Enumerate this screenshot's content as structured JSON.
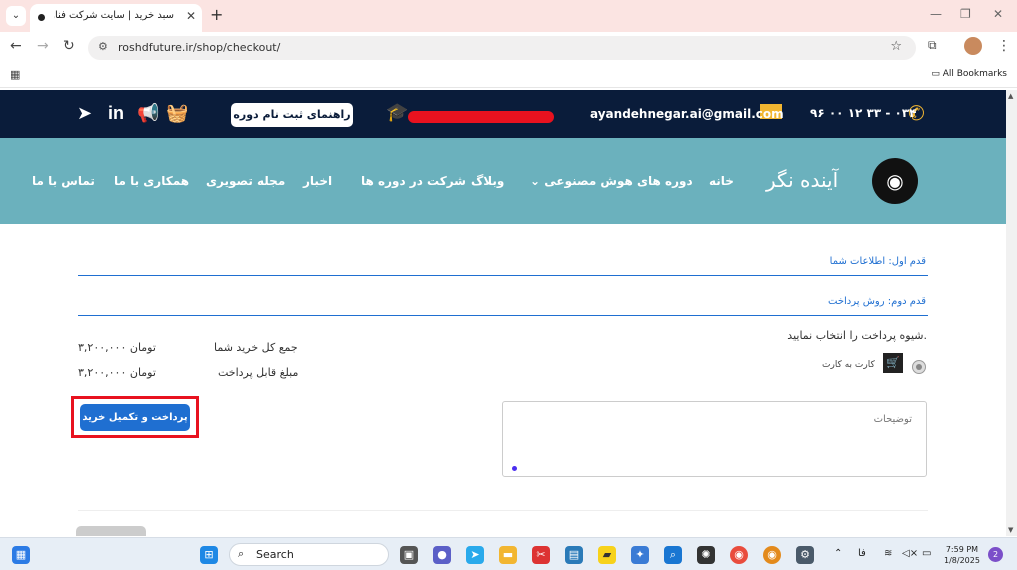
{
  "browser": {
    "tab_title": "سبد خرید | سایت شرکت فناور آینده",
    "url": "roshdfuture.ir/shop/checkout/",
    "all_bookmarks": "All Bookmarks"
  },
  "topbar": {
    "phone": "۰۳۴ - ۳۳ ۱۲ ۰۰ ۹۶",
    "email": "ayandehnegar.ai@gmail.com",
    "register_guide": "راهنمای ثبت نام دوره"
  },
  "navbar": {
    "brand": "آینده نگر",
    "items": [
      "خانه",
      "دوره های هوش مصنوعی",
      "وبلاگ",
      "شرکت در دوره ها",
      "اخبار",
      "مجله تصویری",
      "همکاری با ما",
      "تماس با ما"
    ]
  },
  "checkout": {
    "step1": "قدم اول: اطلاعات شما",
    "step2": "قدم دوم: روش پرداخت",
    "choose_payment": "شیوه پرداخت را انتخاب نمایید.",
    "card_to_card": "کارت به کارت",
    "total_label": "جمع کل خرید شما",
    "total_value": "۳,۲۰۰,۰۰۰ تومان",
    "payable_label": "مبلغ قابل پرداخت",
    "payable_value": "۳,۲۰۰,۰۰۰ تومان",
    "pay_button": "پرداخت و تکمیل خرید",
    "notes_placeholder": "توضیحات"
  },
  "taskbar": {
    "search": "Search",
    "time": "7:59 PM",
    "date": "1/8/2025",
    "lang": "فا",
    "notifications": "2"
  },
  "colors": {
    "topbar_bg": "#0a1c3a",
    "navbar_bg": "#6bb1bd",
    "accent_blue": "#1f6fd1",
    "highlight_red": "#e8121f",
    "icon_gold": "#f2b631"
  }
}
